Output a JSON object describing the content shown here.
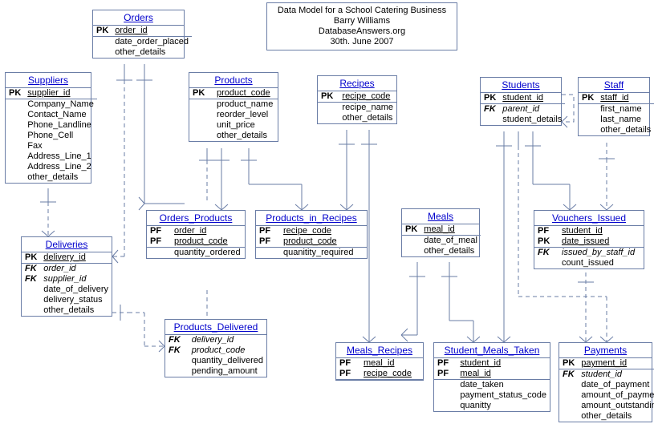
{
  "header": {
    "line1": "Data Model for a School Catering Business",
    "line2": "Barry Williams",
    "line3": "DatabaseAnswers.org",
    "line4": "30th. June 2007"
  },
  "entities": {
    "orders": {
      "title": "Orders",
      "attrs": [
        {
          "key": "PK",
          "name": "order_id",
          "cls": "pk"
        },
        {
          "key": "",
          "name": "date_order_placed"
        },
        {
          "key": "",
          "name": "other_details"
        }
      ]
    },
    "suppliers": {
      "title": "Suppliers",
      "attrs": [
        {
          "key": "PK",
          "name": "supplier_id",
          "cls": "pk"
        },
        {
          "key": "",
          "name": "Company_Name"
        },
        {
          "key": "",
          "name": "Contact_Name"
        },
        {
          "key": "",
          "name": "Phone_Landline"
        },
        {
          "key": "",
          "name": "Phone_Cell"
        },
        {
          "key": "",
          "name": "Fax"
        },
        {
          "key": "",
          "name": "Address_Line_1"
        },
        {
          "key": "",
          "name": "Address_Line_2"
        },
        {
          "key": "",
          "name": "other_details"
        }
      ]
    },
    "products": {
      "title": "Products",
      "attrs": [
        {
          "key": "PK",
          "name": "product_code",
          "cls": "pk"
        },
        {
          "key": "",
          "name": "product_name"
        },
        {
          "key": "",
          "name": "reorder_level"
        },
        {
          "key": "",
          "name": "unit_price"
        },
        {
          "key": "",
          "name": "other_details"
        }
      ]
    },
    "recipes": {
      "title": "Recipes",
      "attrs": [
        {
          "key": "PK",
          "name": "recipe_code",
          "cls": "pk"
        },
        {
          "key": "",
          "name": "recipe_name"
        },
        {
          "key": "",
          "name": "other_details"
        }
      ]
    },
    "students": {
      "title": "Students",
      "attrs": [
        {
          "key": "PK",
          "name": "student_id",
          "cls": "pk"
        },
        {
          "key": "FK",
          "name": "parent_id",
          "cls": "fk"
        },
        {
          "key": "",
          "name": "student_details"
        }
      ]
    },
    "staff": {
      "title": "Staff",
      "attrs": [
        {
          "key": "PK",
          "name": "staff_id",
          "cls": "pk"
        },
        {
          "key": "",
          "name": "first_name"
        },
        {
          "key": "",
          "name": "last_name"
        },
        {
          "key": "",
          "name": "other_details"
        }
      ]
    },
    "orders_products": {
      "title": "Orders_Products",
      "attrs": [
        {
          "key": "PF",
          "name": "order_id",
          "cls": "pk"
        },
        {
          "key": "PF",
          "name": "product_code",
          "cls": "pk"
        },
        {
          "key": "",
          "name": "quantity_ordered"
        }
      ]
    },
    "products_in_recipes": {
      "title": "Products_in_Recipes",
      "attrs": [
        {
          "key": "PF",
          "name": "recipe_code",
          "cls": "pk"
        },
        {
          "key": "PF",
          "name": "product_code",
          "cls": "pk"
        },
        {
          "key": "",
          "name": "quanitity_required"
        }
      ]
    },
    "meals": {
      "title": "Meals",
      "attrs": [
        {
          "key": "PK",
          "name": "meal_id",
          "cls": "pk"
        },
        {
          "key": "",
          "name": "date_of_meal"
        },
        {
          "key": "",
          "name": "other_details"
        }
      ]
    },
    "vouchers_issued": {
      "title": "Vouchers_Issued",
      "attrs": [
        {
          "key": "PF",
          "name": "student_id",
          "cls": "pk"
        },
        {
          "key": "PK",
          "name": "date_issued",
          "cls": "pk"
        },
        {
          "key": "FK",
          "name": "issued_by_staff_id",
          "cls": "fk"
        },
        {
          "key": "",
          "name": "count_issued"
        }
      ]
    },
    "deliveries": {
      "title": "Deliveries",
      "attrs": [
        {
          "key": "PK",
          "name": "delivery_id",
          "cls": "pk"
        },
        {
          "key": "FK",
          "name": "order_id",
          "cls": "fk"
        },
        {
          "key": "FK",
          "name": "supplier_id",
          "cls": "fk"
        },
        {
          "key": "",
          "name": "date_of_delivery"
        },
        {
          "key": "",
          "name": "delivery_status"
        },
        {
          "key": "",
          "name": "other_details"
        }
      ]
    },
    "products_delivered": {
      "title": "Products_Delivered",
      "attrs": [
        {
          "key": "FK",
          "name": "delivery_id",
          "cls": "fk"
        },
        {
          "key": "FK",
          "name": "product_code",
          "cls": "fk"
        },
        {
          "key": "",
          "name": "quantity_delivered"
        },
        {
          "key": "",
          "name": "pending_amount"
        }
      ]
    },
    "meals_recipes": {
      "title": "Meals_Recipes",
      "attrs": [
        {
          "key": "PF",
          "name": "meal_id",
          "cls": "pk"
        },
        {
          "key": "PF",
          "name": "recipe_code",
          "cls": "pk"
        }
      ]
    },
    "student_meals_taken": {
      "title": "Student_Meals_Taken",
      "attrs": [
        {
          "key": "PF",
          "name": "student_id",
          "cls": "pk"
        },
        {
          "key": "PF",
          "name": "meal_id",
          "cls": "pk"
        },
        {
          "key": "",
          "name": "date_taken"
        },
        {
          "key": "",
          "name": "payment_status_code"
        },
        {
          "key": "",
          "name": "quanitty"
        }
      ]
    },
    "payments": {
      "title": "Payments",
      "attrs": [
        {
          "key": "PK",
          "name": "payment_id",
          "cls": "pk"
        },
        {
          "key": "FK",
          "name": "student_id",
          "cls": "fk"
        },
        {
          "key": "",
          "name": "date_of_payment"
        },
        {
          "key": "",
          "name": "amount_of_payment"
        },
        {
          "key": "",
          "name": "amount_outstanding"
        },
        {
          "key": "",
          "name": "other_details"
        }
      ]
    }
  },
  "relationships": [
    {
      "from": "orders",
      "to": "orders_products",
      "type": "identifying"
    },
    {
      "from": "products",
      "to": "orders_products",
      "type": "identifying"
    },
    {
      "from": "products",
      "to": "products_in_recipes",
      "type": "identifying"
    },
    {
      "from": "recipes",
      "to": "products_in_recipes",
      "type": "identifying"
    },
    {
      "from": "recipes",
      "to": "meals_recipes",
      "type": "identifying"
    },
    {
      "from": "meals",
      "to": "meals_recipes",
      "type": "identifying"
    },
    {
      "from": "meals",
      "to": "student_meals_taken",
      "type": "identifying"
    },
    {
      "from": "students",
      "to": "student_meals_taken",
      "type": "identifying"
    },
    {
      "from": "students",
      "to": "vouchers_issued",
      "type": "identifying"
    },
    {
      "from": "staff",
      "to": "vouchers_issued",
      "type": "non-identifying"
    },
    {
      "from": "students",
      "to": "payments",
      "type": "non-identifying"
    },
    {
      "from": "suppliers",
      "to": "deliveries",
      "type": "non-identifying"
    },
    {
      "from": "orders",
      "to": "deliveries",
      "type": "non-identifying"
    },
    {
      "from": "deliveries",
      "to": "products_delivered",
      "type": "non-identifying"
    },
    {
      "from": "products",
      "to": "products_delivered",
      "type": "non-identifying"
    },
    {
      "from": "students",
      "to": "students",
      "type": "self",
      "note": "parent_id"
    },
    {
      "from": "vouchers_issued",
      "to": "payments",
      "type": "non-identifying"
    }
  ]
}
